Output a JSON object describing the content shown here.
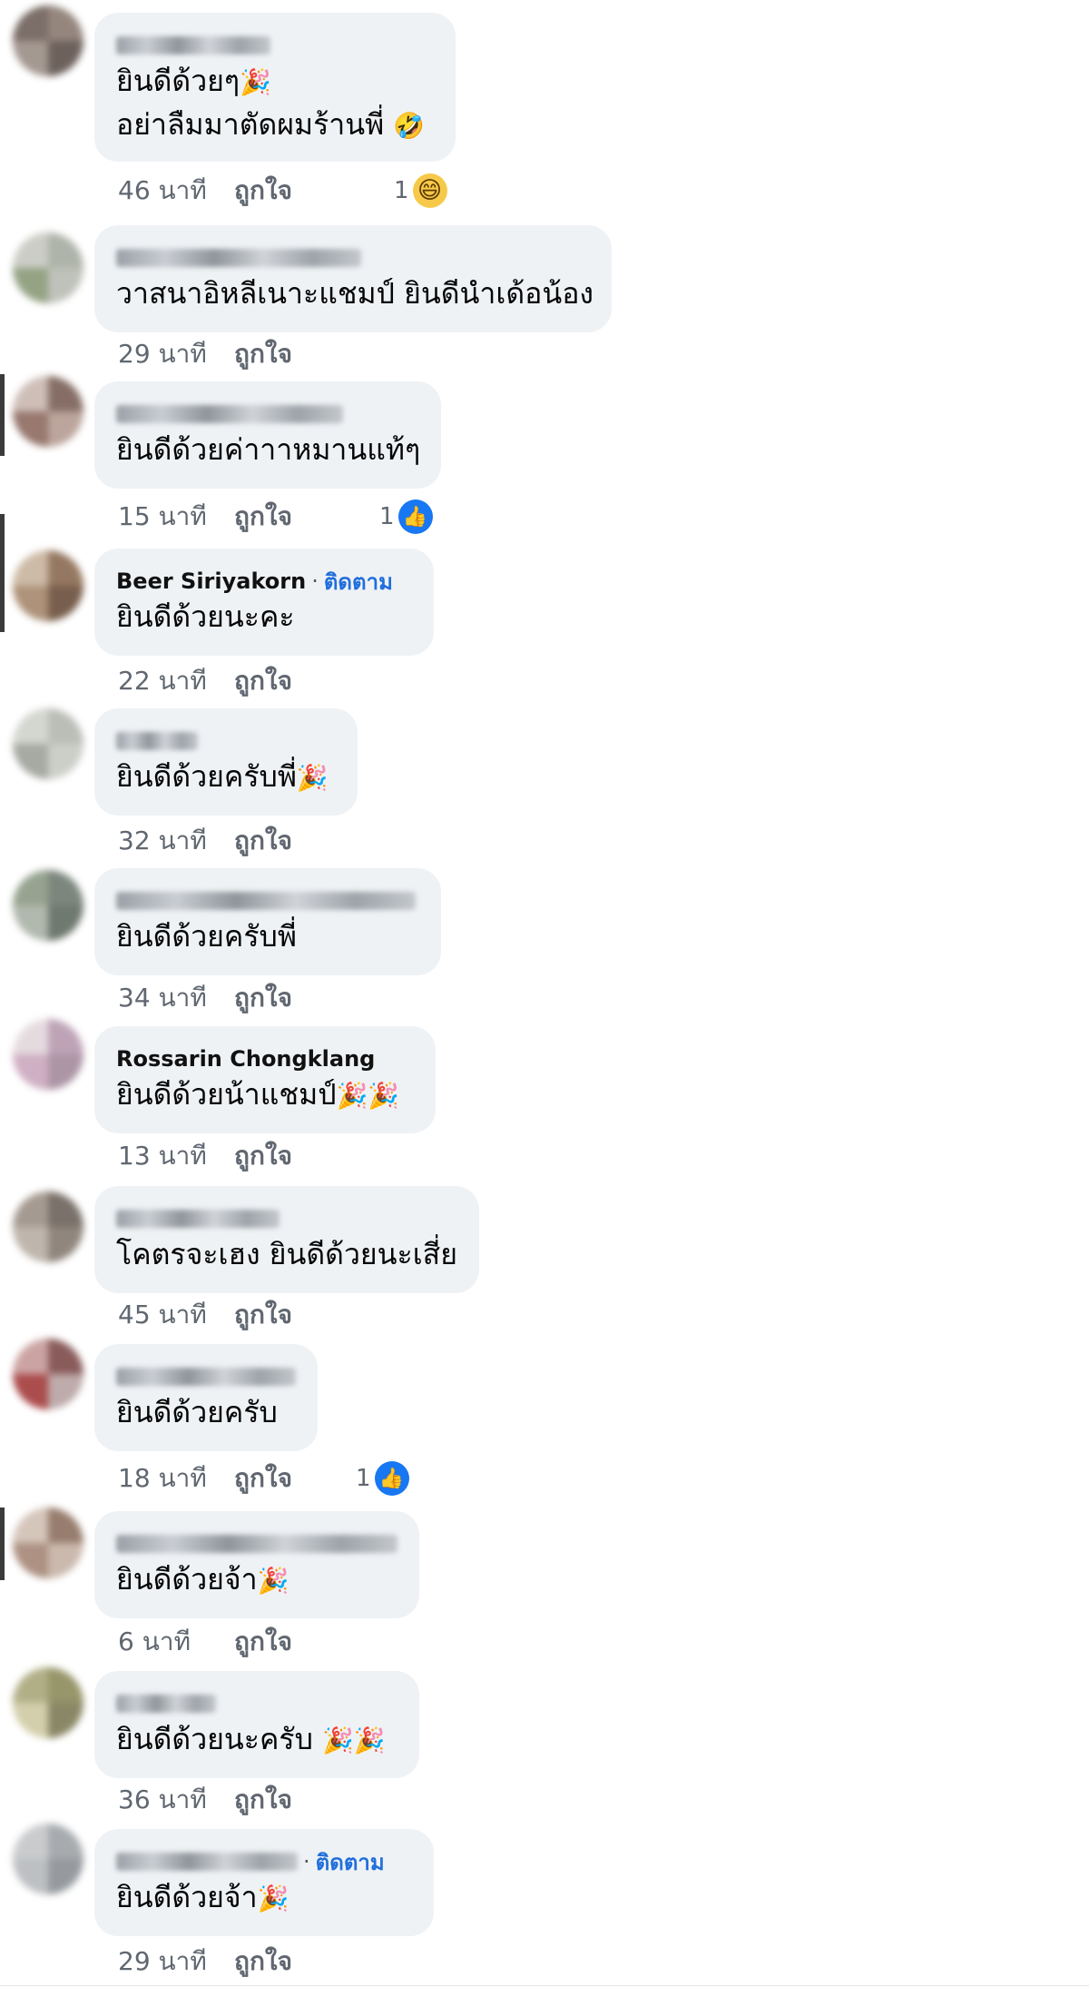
{
  "labels": {
    "like": "ถูกใจ",
    "follow": "ติดตาม"
  },
  "comments": [
    {
      "author": "",
      "lines": [
        "ยินดีด้วยๆ",
        "อย่าลืมมาตัดผมร้านพี่ "
      ],
      "emojis": [
        "party-popper-emoji",
        "rofl-emoji"
      ],
      "time": "46 นาที",
      "reaction": {
        "type": "haha",
        "count": "1"
      }
    },
    {
      "author": "",
      "lines": [
        "วาสนาอิหลีเนาะแชมป์ ยินดีนำเด้อน้อง"
      ],
      "time": "29 นาที"
    },
    {
      "author": "",
      "lines": [
        "ยินดีด้วยค่าาาหมานแท้ๆ"
      ],
      "time": "15 นาที",
      "reaction": {
        "type": "like",
        "count": "1"
      }
    },
    {
      "author": "Beer Siriyakorn",
      "follow": true,
      "lines": [
        "ยินดีด้วยนะคะ"
      ],
      "time": "22 นาที"
    },
    {
      "author": "",
      "lines": [
        "ยินดีด้วยครับพี่"
      ],
      "emojis": [
        "party-popper-emoji"
      ],
      "time": "32 นาที"
    },
    {
      "author": "",
      "lines": [
        "ยินดีด้วยครับพี่"
      ],
      "time": "34 นาที"
    },
    {
      "author": "Rossarin Chongklang",
      "lines": [
        "ยินดีด้วยน้าแชมป์"
      ],
      "emojis": [
        "party-popper-emoji",
        "party-popper-emoji"
      ],
      "time": "13 นาที"
    },
    {
      "author": "",
      "lines": [
        "โคตรจะเฮง ยินดีด้วยนะเสี่ย"
      ],
      "time": "45 นาที"
    },
    {
      "author": "",
      "lines": [
        "ยินดีด้วยครับ"
      ],
      "time": "18 นาที",
      "reaction": {
        "type": "like",
        "count": "1"
      }
    },
    {
      "author": "",
      "lines": [
        "ยินดีด้วยจ้า"
      ],
      "emojis": [
        "party-popper-emoji"
      ],
      "time": "6 นาที"
    },
    {
      "author": "",
      "lines": [
        "ยินดีด้วยนะครับ "
      ],
      "emojis": [
        "party-popper-emoji",
        "party-popper-emoji"
      ],
      "time": "36 นาที"
    },
    {
      "author": "",
      "follow": true,
      "lines": [
        "ยินดีด้วยจ้า"
      ],
      "emojis": [
        "party-popper-emoji"
      ],
      "time": "29 นาที"
    }
  ]
}
